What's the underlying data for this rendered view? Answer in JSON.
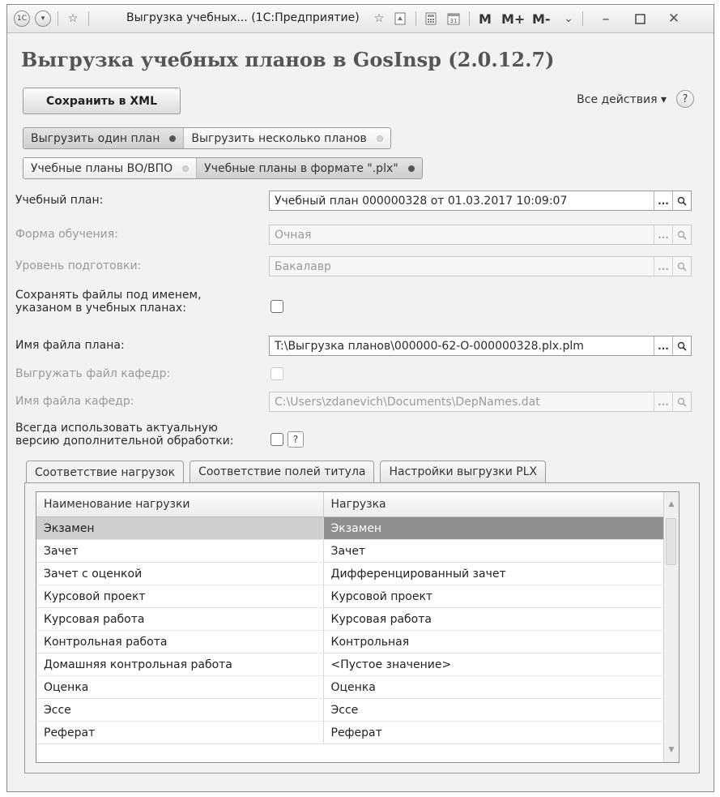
{
  "window": {
    "title": "Выгрузка учебных... (1С:Предприятие)",
    "logo_text": "1С",
    "m_label": "M",
    "mplus_label": "M+",
    "mminus_label": "M-"
  },
  "form": {
    "title": "Выгрузка учебных планов в GosInsp (2.0.12.7)",
    "save_xml_label": "Сохранить в XML",
    "all_actions_label": "Все действия ▾",
    "help_label": "?"
  },
  "mode_switch": [
    {
      "label": "Выгрузить один план",
      "active": true
    },
    {
      "label": "Выгрузить несколько планов",
      "active": false
    }
  ],
  "format_switch": [
    {
      "label": "Учебные планы ВО/ВПО",
      "active": false
    },
    {
      "label": "Учебные планы в формате \".plx\"",
      "active": true
    }
  ],
  "fields": {
    "plan_label": "Учебный план:",
    "plan_value": "Учебный план 000000328 от 01.03.2017 10:09:07",
    "form_label": "Форма обучения:",
    "form_value": "Очная",
    "level_label": "Уровень подготовки:",
    "level_value": "Бакалавр",
    "save_names_label_1": "Сохранять файлы под именем,",
    "save_names_label_2": "указаном в учебных планах:",
    "save_names_checked": false,
    "file_label": "Имя файла плана:",
    "file_value": "T:\\Выгрузка планов\\000000-62-О-000000328.plx.plm",
    "dept_export_label": "Выгружать файл кафедр:",
    "dept_file_label": "Имя файла кафедр:",
    "dept_file_value": "C:\\Users\\zdanevich\\Documents\\DepNames.dat",
    "actual_version_label_1": "Всегда использовать актуальную",
    "actual_version_label_2": "версию дополнительной обработки:",
    "actual_version_help": "?",
    "ellipsis": "..."
  },
  "tabs": [
    {
      "label": "Соответствие нагрузок",
      "active": true
    },
    {
      "label": "Соответствие полей титула",
      "active": false
    },
    {
      "label": "Настройки выгрузки PLX",
      "active": false
    }
  ],
  "table": {
    "columns": [
      "Наименование нагрузки",
      "Нагрузка"
    ],
    "rows": [
      [
        "Экзамен",
        "Экзамен"
      ],
      [
        "Зачет",
        "Зачет"
      ],
      [
        "Зачет с оценкой",
        "Дифференцированный зачет"
      ],
      [
        "Курсовой проект",
        "Курсовой проект"
      ],
      [
        "Курсовая работа",
        "Курсовая работа"
      ],
      [
        "Контрольная работа",
        "Контрольная"
      ],
      [
        "Домашняя контрольная работа",
        "<Пустое значение>"
      ],
      [
        "Оценка",
        "Оценка"
      ],
      [
        "Эссе",
        "Эссе"
      ],
      [
        "Реферат",
        "Реферат"
      ]
    ],
    "selected_row": 0
  }
}
